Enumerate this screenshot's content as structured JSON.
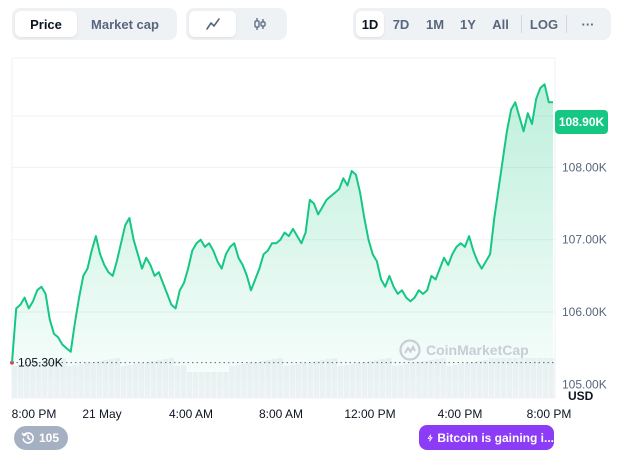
{
  "toolbar": {
    "metric_tabs": [
      {
        "label": "Price",
        "active": true
      },
      {
        "label": "Market cap",
        "active": false
      }
    ],
    "chart_type_icons": [
      {
        "icon": "line-chart-icon",
        "active": true
      },
      {
        "icon": "candlestick-icon",
        "active": false
      }
    ],
    "ranges": [
      {
        "label": "1D",
        "active": true
      },
      {
        "label": "7D",
        "active": false
      },
      {
        "label": "1M",
        "active": false
      },
      {
        "label": "1Y",
        "active": false
      },
      {
        "label": "All",
        "active": false
      }
    ],
    "log_label": "LOG",
    "more_label": "···"
  },
  "chart_data": {
    "type": "area",
    "y_unit": "USD",
    "ylim": [
      104700,
      109300
    ],
    "y_ticks": [
      {
        "value": 105000,
        "label": "105.00K"
      },
      {
        "value": 106000,
        "label": "106.00K"
      },
      {
        "value": 107000,
        "label": "107.00K"
      },
      {
        "value": 108000,
        "label": "108.00K"
      }
    ],
    "x_ticks": [
      "8:00 PM",
      "21 May",
      "4:00 AM",
      "8:00 AM",
      "12:00 PM",
      "4:00 PM",
      "8:00 PM"
    ],
    "open_price_label": "105.30K",
    "open_price": 105300,
    "current_price_label": "108.90K",
    "current_price": 108900,
    "line_color": "#16c784",
    "grid": true,
    "series": [
      {
        "values": [
          105300,
          106050,
          106100,
          106200,
          106050,
          106150,
          106300,
          106350,
          106250,
          105900,
          105700,
          105650,
          105550,
          105500,
          105450,
          105850,
          106200,
          106500,
          106600,
          106850,
          107050,
          106800,
          106650,
          106550,
          106500,
          106700,
          106950,
          107200,
          107300,
          107000,
          106800,
          106600,
          106750,
          106650,
          106500,
          106550,
          106400,
          106250,
          106100,
          106050,
          106300,
          106400,
          106600,
          106850,
          106950,
          107000,
          106900,
          106950,
          106850,
          106700,
          106600,
          106800,
          106900,
          106950,
          106750,
          106650,
          106500,
          106300,
          106450,
          106600,
          106800,
          106850,
          106950,
          106950,
          107000,
          107100,
          107050,
          107150,
          107050,
          106950,
          107100,
          107550,
          107500,
          107350,
          107450,
          107550,
          107600,
          107650,
          107700,
          107850,
          107750,
          107950,
          107900,
          107650,
          107300,
          107000,
          106800,
          106700,
          106450,
          106350,
          106500,
          106350,
          106250,
          106300,
          106200,
          106150,
          106200,
          106300,
          106250,
          106300,
          106500,
          106450,
          106600,
          106750,
          106650,
          106800,
          106900,
          106950,
          106900,
          107050,
          106850,
          106700,
          106600,
          106700,
          106800,
          107300,
          107700,
          108100,
          108500,
          108800,
          108900,
          108700,
          108500,
          108750,
          108600,
          108950,
          109100,
          109150,
          108900,
          108900
        ]
      }
    ],
    "volume_bars": true
  },
  "watermark": "CoinMarketCap",
  "badges": {
    "history_count": "105",
    "news": "Bitcoin is gaining i..."
  },
  "colors": {
    "up": "#16c784",
    "news": "#8c3cf6",
    "open_dot": "#ea3943"
  }
}
